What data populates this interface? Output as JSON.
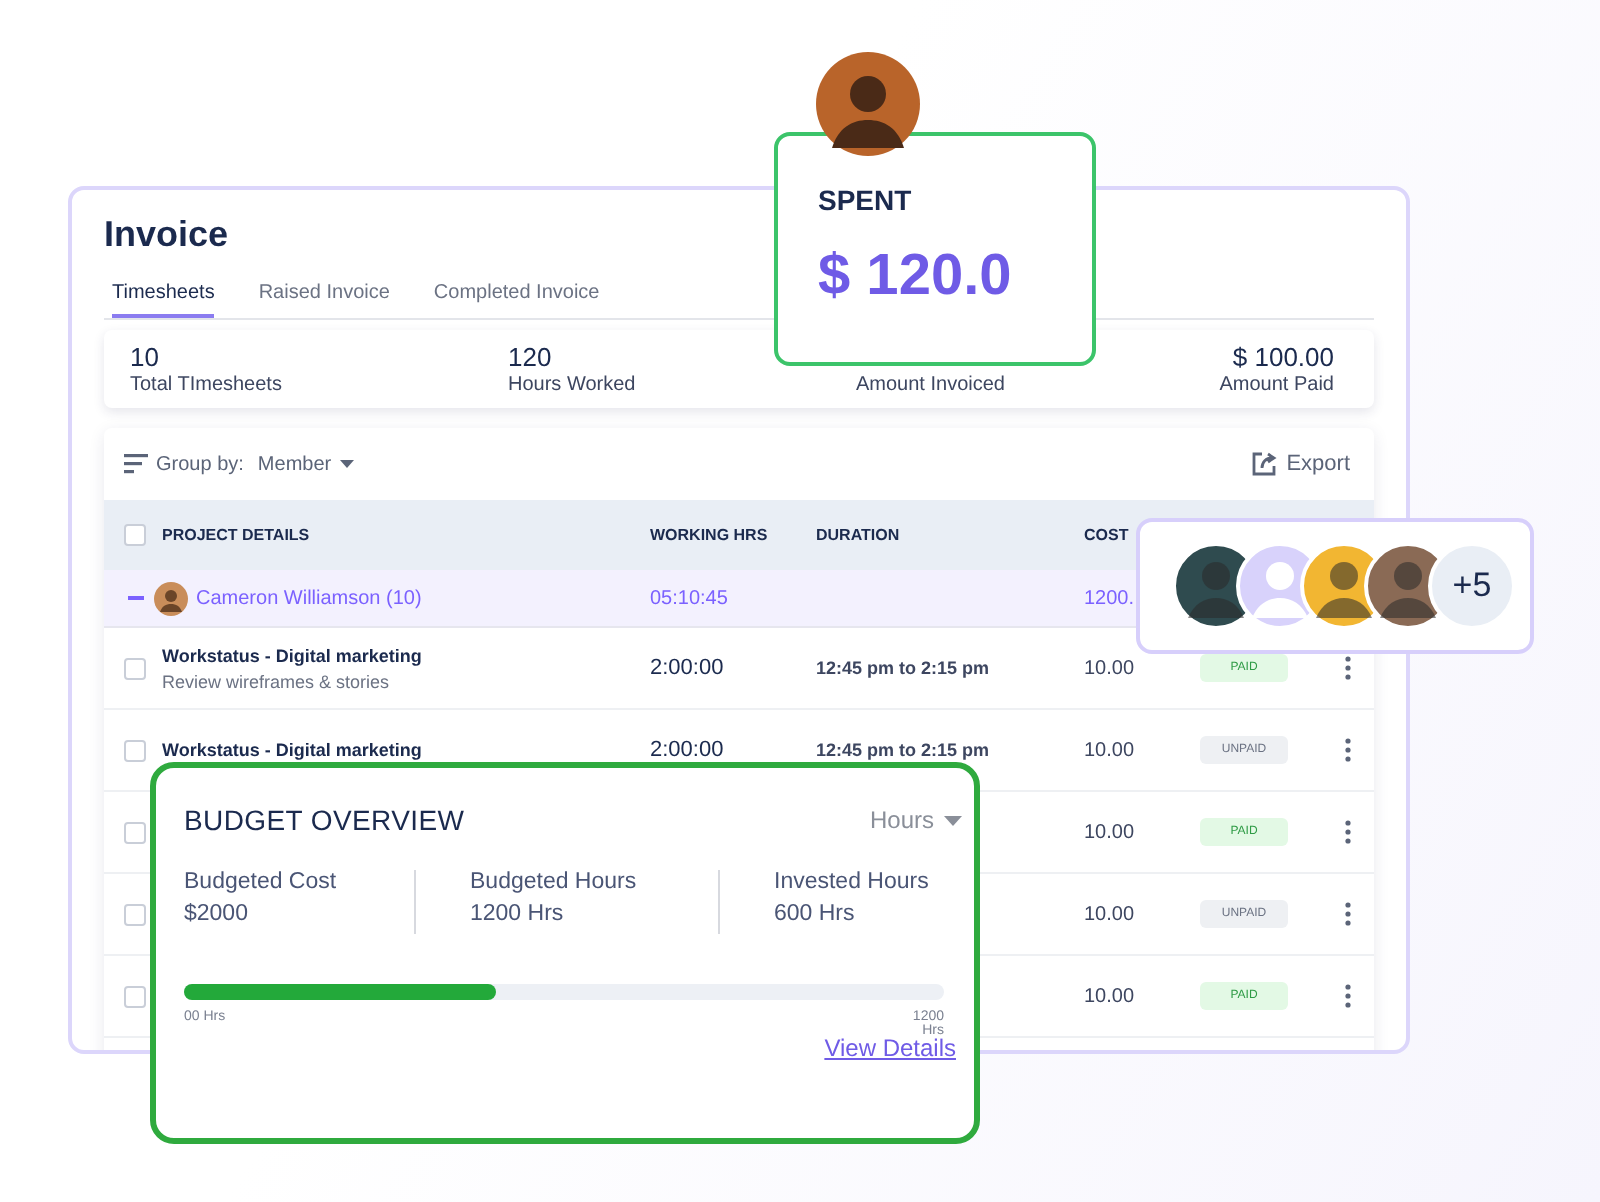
{
  "invoice": {
    "title": "Invoice",
    "tabs": [
      {
        "label": "Timesheets",
        "selected": true
      },
      {
        "label": "Raised Invoice",
        "selected": false
      },
      {
        "label": "Completed Invoice",
        "selected": false
      }
    ],
    "stats": [
      {
        "value": "10",
        "label": "Total TImesheets"
      },
      {
        "value": "120",
        "label": "Hours Worked"
      },
      {
        "label": "Amount Invoiced"
      },
      {
        "value": "$ 100.00",
        "label": "Amount Paid"
      }
    ],
    "group_by": {
      "label": "Group by:",
      "value": "Member"
    },
    "export": "Export",
    "table": {
      "select_all_checked": false,
      "columns": [
        "PROJECT DETAILS",
        "WORKING HRS",
        "DURATION",
        "COST"
      ],
      "group": {
        "name": "Cameron Williamson (10)",
        "working_hrs": "05:10:45",
        "cost": "1200."
      },
      "rows": [
        {
          "checked": false,
          "project": "Workstatus - Digital marketing",
          "task": "Review wireframes & stories",
          "working_hrs": "2:00:00",
          "duration": "12:45 pm to 2:15 pm",
          "cost": "10.00",
          "status": "PAID",
          "kind": "paid"
        },
        {
          "checked": false,
          "project": "Workstatus - Digital marketing",
          "working_hrs": "2:00:00",
          "duration": "12:45 pm to 2:15 pm",
          "cost": "10.00",
          "status": "UNPAID",
          "kind": "unpaid"
        },
        {
          "checked": false,
          "cost": "10.00",
          "status": "PAID",
          "kind": "paid"
        },
        {
          "checked": false,
          "cost": "10.00",
          "status": "UNPAID",
          "kind": "unpaid"
        },
        {
          "checked": false,
          "cost": "10.00",
          "status": "PAID",
          "kind": "paid"
        }
      ]
    }
  },
  "spent": {
    "label": "SPENT",
    "amount": "$ 120.0"
  },
  "team": {
    "more": "+5"
  },
  "budget": {
    "title": "BUDGET OVERVIEW",
    "unit": "Hours",
    "stats": [
      {
        "label": "Budgeted Cost",
        "value": "$2000"
      },
      {
        "label": "Budgeted Hours",
        "value": "1200 Hrs"
      },
      {
        "label": "Invested Hours",
        "value": "600 Hrs"
      }
    ],
    "level": 0.41,
    "min_label": "00 Hrs",
    "max_label": "1200 Hrs",
    "link": "View Details"
  }
}
